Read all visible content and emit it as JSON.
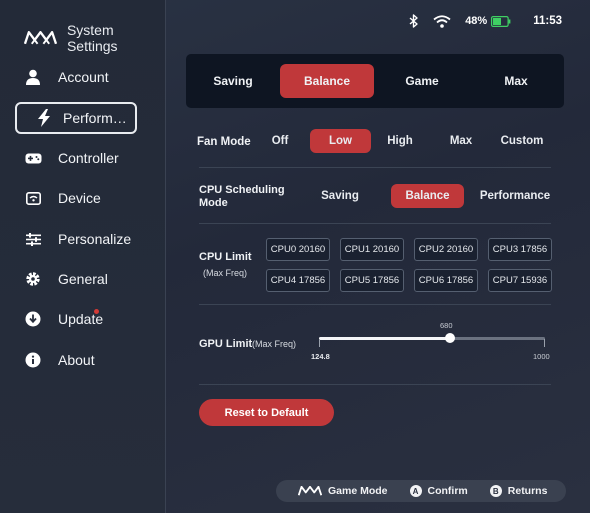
{
  "app": {
    "title": "System Settings"
  },
  "status": {
    "battery": "48%",
    "time": "11:53",
    "battery_color": "#3fcf63"
  },
  "sidebar": {
    "items": [
      {
        "label": "Account",
        "icon": "person-icon"
      },
      {
        "label": "Perform…",
        "icon": "lightning-icon",
        "active": true
      },
      {
        "label": "Controller",
        "icon": "gamepad-icon"
      },
      {
        "label": "Device",
        "icon": "device-icon"
      },
      {
        "label": "Personalize",
        "icon": "sliders-icon"
      },
      {
        "label": "General",
        "icon": "gear-icon"
      },
      {
        "label": "Update",
        "icon": "download-icon",
        "badge": true
      },
      {
        "label": "About",
        "icon": "info-icon"
      }
    ]
  },
  "mode_tabs": {
    "items": [
      "Saving",
      "Balance",
      "Game",
      "Max"
    ],
    "selected": "Balance"
  },
  "fan_mode": {
    "label": "Fan Mode",
    "options": [
      "Off",
      "Low",
      "High",
      "Max",
      "Custom"
    ],
    "selected": "Low"
  },
  "cpu_scheduling": {
    "label_line1": "CPU Scheduling",
    "label_line2": "Mode",
    "options": [
      "Saving",
      "Balance",
      "Performance"
    ],
    "selected": "Balance"
  },
  "cpu_limit": {
    "label": "CPU Limit",
    "sublabel": "(Max Freq)",
    "cores": [
      "CPU0 20160",
      "CPU1 20160",
      "CPU2 20160",
      "CPU3 17856",
      "CPU4 17856",
      "CPU5 17856",
      "CPU6 17856",
      "CPU7 15936"
    ]
  },
  "gpu_limit": {
    "label": "GPU Limit",
    "sublabel": "(Max Freq)",
    "min": "124.8",
    "max": "1000",
    "value": "680",
    "fraction": 0.58
  },
  "reset_button": "Reset to Default",
  "footer": {
    "game_mode": "Game Mode",
    "confirm_key": "A",
    "confirm": "Confirm",
    "returns_key": "B",
    "returns": "Returns"
  },
  "colors": {
    "accent": "#c0383a",
    "panel": "#0e1522"
  }
}
